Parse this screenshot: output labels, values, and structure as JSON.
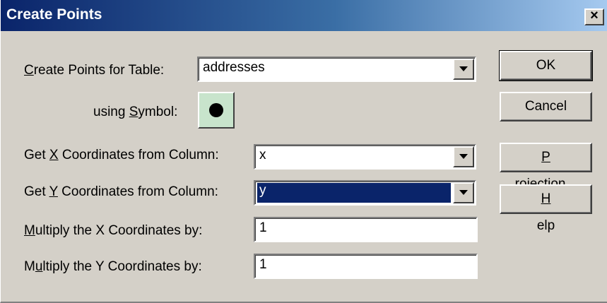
{
  "window": {
    "title": "Create Points",
    "close_glyph": "×"
  },
  "form": {
    "table_label_mn": "C",
    "table_label_rest": "reate Points for Table:",
    "table_value": "addresses",
    "symbol_label_pre": "using ",
    "symbol_label_mn": "S",
    "symbol_label_post": "ymbol:",
    "x_col_label_pre": "Get ",
    "x_col_label_mn": "X",
    "x_col_label_post": " Coordinates from Column:",
    "x_col_value": "x",
    "y_col_label_pre": "Get ",
    "y_col_label_mn": "Y",
    "y_col_label_post": " Coordinates from Column:",
    "y_col_value": "y",
    "mult_x_label_mn": "M",
    "mult_x_label_rest": "ultiply the X Coordinates by:",
    "mult_x_value": "1",
    "mult_y_label_pre": "M",
    "mult_y_label_mn": "u",
    "mult_y_label_rest": "ltiply the Y Coordinates by:",
    "mult_y_value": "1"
  },
  "buttons": {
    "ok": "OK",
    "cancel": "Cancel",
    "projection_mn": "P",
    "projection_rest": "rojection...",
    "help_mn": "H",
    "help_rest": "elp"
  },
  "icons": {
    "close": "close-icon",
    "dropdown": "chevron-down-icon",
    "symbol": "filled-circle-icon"
  }
}
